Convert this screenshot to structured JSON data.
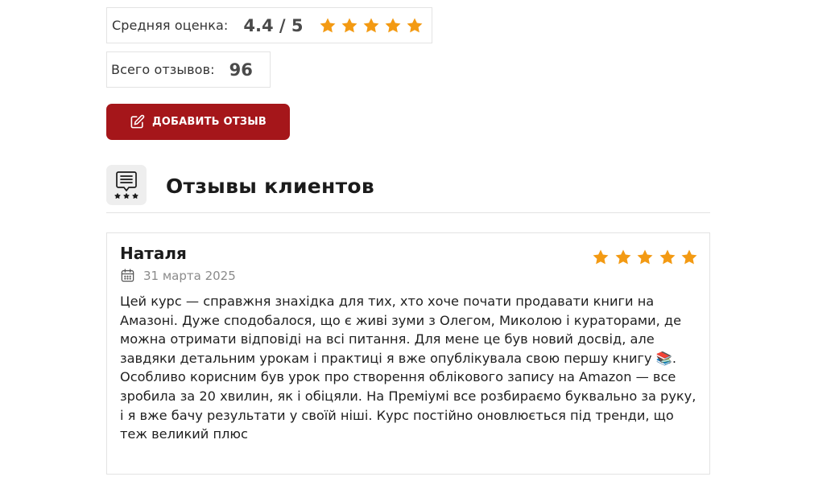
{
  "stats": {
    "avg_label": "Средняя оценка:",
    "avg_value": "4.4 / 5",
    "avg_stars": 5,
    "total_label": "Всего отзывов:",
    "total_value": "96"
  },
  "actions": {
    "add_review_label": "ДОБАВИТЬ ОТЗЫВ",
    "add_review_icon": "edit-icon"
  },
  "section": {
    "title": "Отзывы клиентов",
    "icon": "review-chat-stars-icon"
  },
  "reviews": [
    {
      "author": "Наталя",
      "date": "31 марта 2025",
      "rating": 5,
      "text": "Цей курс — справжня знахідка для тих, хто хоче почати продавати книги на Амазоні. Дуже сподобалося, що є живі зуми з Олегом, Миколою і кураторами, де можна отримати відповіді на всі питання. Для мене це був новий досвід, але завдяки детальним урокам і практиці я вже опублікувала свою першу книгу 📚. Особливо корисним був урок про створення облікового запису на Amazon — все зробила за 20 хвилин, як і обіцяли. На Преміумі все розбираємо буквально за руку, і я вже бачу результати у своїй ніші. Курс постійно оновлюється під тренди, що теж великий плюс"
    }
  ],
  "colors": {
    "star": "#f39a13",
    "button": "#a5161a",
    "border": "#e3e3e3"
  }
}
